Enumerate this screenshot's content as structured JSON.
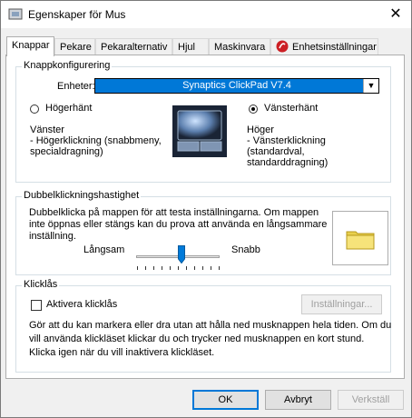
{
  "window": {
    "title": "Egenskaper för Mus"
  },
  "tabs": [
    {
      "label": "Knappar"
    },
    {
      "label": "Pekare"
    },
    {
      "label": "Pekaralternativ"
    },
    {
      "label": "Hjul"
    },
    {
      "label": "Maskinvara"
    },
    {
      "label": "Enhetsinställningar"
    }
  ],
  "button_config": {
    "title": "Knappkonfigurering",
    "device_label": "Enheter:",
    "device_value": "Synaptics ClickPad V7.4",
    "right_handed": {
      "label": "Högerhänt",
      "checked": false
    },
    "left_handed": {
      "label": "Vänsterhänt",
      "checked": true
    },
    "left_title": "Vänster",
    "left_desc_1": " - Högerklickning (snabbmeny,",
    "left_desc_2": "specialdragning)",
    "right_title": "Höger",
    "right_desc_1": " - Vänsterklickning",
    "right_desc_2": "(standardval,",
    "right_desc_3": "standarddragning)"
  },
  "double_click": {
    "title": "Dubbelklickningshastighet",
    "desc_1": "Dubbelklicka på mappen för att testa inställningarna. Om mappen",
    "desc_2": "inte öppnas eller stängs kan du prova att använda en långsammare",
    "desc_3": "inställning.",
    "slow_label": "Långsam",
    "fast_label": "Snabb",
    "speed_fraction": 0.54
  },
  "click_lock": {
    "title": "Klicklås",
    "checkbox_label": "Aktivera klicklås",
    "checked": false,
    "settings_button": "Inställningar...",
    "desc_1": "Gör att du kan markera eller dra utan att hålla ned musknappen hela tiden. Om du",
    "desc_2": "vill använda klickläset klickar du och trycker ned musknappen en kort stund.",
    "desc_3": "Klicka igen när du vill inaktivera klickläset."
  },
  "footer": {
    "ok": "OK",
    "cancel": "Avbryt",
    "apply": "Verkställ"
  },
  "colors": {
    "accent": "#0078d7",
    "folder": "#f2e36b"
  }
}
